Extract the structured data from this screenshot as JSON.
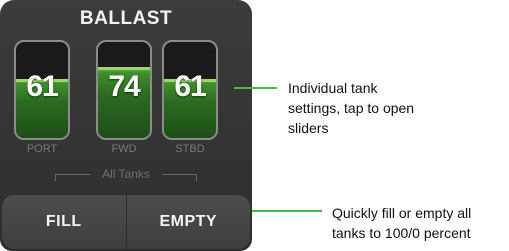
{
  "panel": {
    "title": "BALLAST",
    "tanks": [
      {
        "value": "61",
        "label": "PORT",
        "fill_percent": 61
      },
      {
        "value": "74",
        "label": "FWD",
        "fill_percent": 74
      },
      {
        "value": "61",
        "label": "STBD",
        "fill_percent": 61
      }
    ],
    "all_tanks_label": "All Tanks",
    "buttons": {
      "fill": "FILL",
      "empty": "EMPTY"
    }
  },
  "callouts": {
    "tanks": {
      "line1": "Individual tank",
      "line2": "settings, tap to open",
      "line3": "sliders"
    },
    "buttons": {
      "line1": "Quickly fill or empty all",
      "line2": "tanks to 100/0 percent"
    }
  },
  "colors": {
    "accent": "#49b84a",
    "tank_fill": "#2b6b20",
    "panel_bg": "#363636"
  }
}
